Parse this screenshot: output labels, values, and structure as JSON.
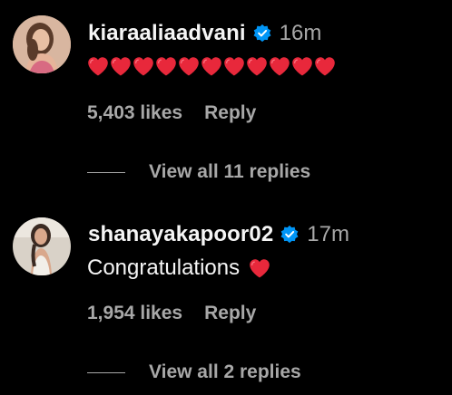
{
  "comments": [
    {
      "username": "kiaraaliaadvani",
      "verified": true,
      "time": "16m",
      "text": "",
      "emoji": [
        "red-heart",
        "red-heart",
        "red-heart",
        "red-heart",
        "red-heart",
        "red-heart",
        "red-heart",
        "red-heart",
        "red-heart",
        "red-heart",
        "red-heart"
      ],
      "likes": "5,403 likes",
      "reply_label": "Reply",
      "view_replies": "View all 11 replies"
    },
    {
      "username": "shanayakapoor02",
      "verified": true,
      "time": "17m",
      "text": "Congratulations",
      "emoji": [
        "red-heart"
      ],
      "likes": "1,954 likes",
      "reply_label": "Reply",
      "view_replies": "View all 2 replies"
    }
  ],
  "colors": {
    "background": "#000000",
    "primary_text": "#f5f5f5",
    "secondary_text": "#a8a8a8",
    "verified_badge": "#0095f6",
    "heart": "#e8283b"
  }
}
